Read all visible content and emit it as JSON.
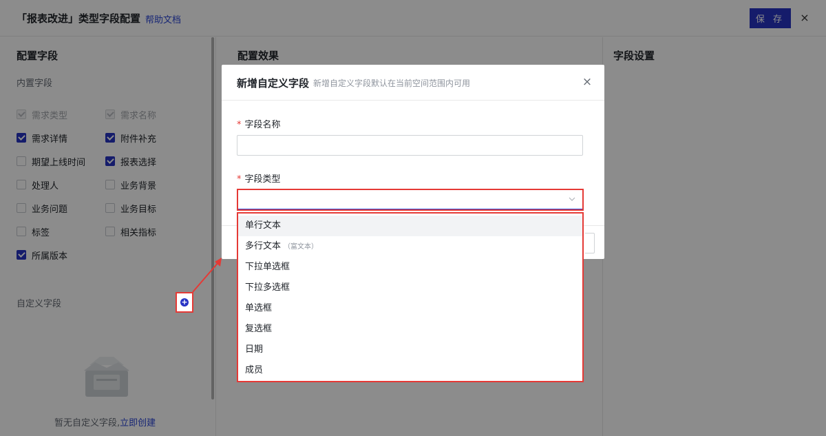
{
  "header": {
    "title": "「报表改进」类型字段配置",
    "help_link": "帮助文档",
    "save_label": "保 存",
    "close_glyph": "×"
  },
  "left_panel": {
    "title": "配置字段",
    "builtin_label": "内置字段",
    "builtin_fields": [
      {
        "label": "需求类型",
        "state": "disabled"
      },
      {
        "label": "需求名称",
        "state": "disabled"
      },
      {
        "label": "需求详情",
        "state": "checked"
      },
      {
        "label": "附件补充",
        "state": "checked"
      },
      {
        "label": "期望上线时间",
        "state": "unchecked"
      },
      {
        "label": "报表选择",
        "state": "checked"
      },
      {
        "label": "处理人",
        "state": "unchecked"
      },
      {
        "label": "业务背景",
        "state": "unchecked"
      },
      {
        "label": "业务问题",
        "state": "unchecked"
      },
      {
        "label": "业务目标",
        "state": "unchecked"
      },
      {
        "label": "标签",
        "state": "unchecked"
      },
      {
        "label": "相关指标",
        "state": "unchecked"
      },
      {
        "label": "所属版本",
        "state": "checked"
      }
    ],
    "custom_label": "自定义字段",
    "add_glyph": "+",
    "empty_text": "暂无自定义字段,",
    "create_link": "立即创建"
  },
  "middle_panel": {
    "title": "配置效果"
  },
  "right_panel": {
    "title": "字段设置"
  },
  "modal": {
    "title": "新增自定义字段",
    "subtitle": "新增自定义字段默认在当前空间范围内可用",
    "close_glyph": "×",
    "required_mark": "*",
    "name_label": "字段名称",
    "name_value": "",
    "type_label": "字段类型",
    "type_value": "",
    "type_options": [
      {
        "label": "单行文本",
        "note": "",
        "active": true
      },
      {
        "label": "多行文本",
        "note": "（富文本）",
        "active": false
      },
      {
        "label": "下拉单选框",
        "note": "",
        "active": false
      },
      {
        "label": "下拉多选框",
        "note": "",
        "active": false
      },
      {
        "label": "单选框",
        "note": "",
        "active": false
      },
      {
        "label": "复选框",
        "note": "",
        "active": false
      },
      {
        "label": "日期",
        "note": "",
        "active": false
      },
      {
        "label": "成员",
        "note": "",
        "active": false
      }
    ]
  },
  "colors": {
    "primary": "#2733c4",
    "link": "#2b45d6",
    "highlight": "#e53935"
  }
}
